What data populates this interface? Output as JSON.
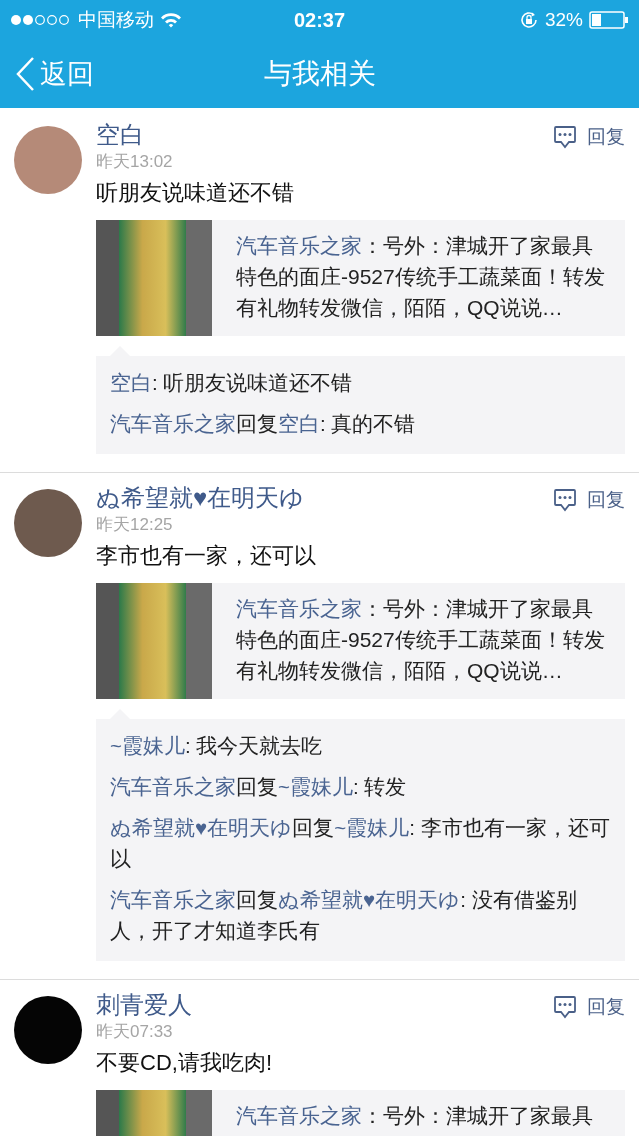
{
  "status_bar": {
    "carrier": "中国移动",
    "time": "02:37",
    "battery": "32%"
  },
  "nav": {
    "back_label": "返回",
    "title": "与我相关"
  },
  "posts": [
    {
      "author": "空白",
      "time": "昨天13:02",
      "text": "听朋友说味道还不错",
      "reply_label": "回复",
      "shared": {
        "source": "汽车音乐之家",
        "text": "：号外：津城开了家最具特色的面庄-9527传统手工蔬菜面！转发有礼物转发微信，陌陌，QQ说说…"
      },
      "comments": [
        {
          "parts": [
            {
              "kind": "name",
              "text": "空白"
            },
            {
              "kind": "text",
              "text": ": 听朋友说味道还不错"
            }
          ]
        },
        {
          "parts": [
            {
              "kind": "name",
              "text": "汽车音乐之家"
            },
            {
              "kind": "text",
              "text": "回复"
            },
            {
              "kind": "name",
              "text": "空白"
            },
            {
              "kind": "text",
              "text": ": 真的不错"
            }
          ]
        }
      ]
    },
    {
      "author": "ぬ希望就♥在明天ゆ",
      "time": "昨天12:25",
      "text": "李市也有一家，还可以",
      "reply_label": "回复",
      "shared": {
        "source": "汽车音乐之家",
        "text": "：号外：津城开了家最具特色的面庄-9527传统手工蔬菜面！转发有礼物转发微信，陌陌，QQ说说…"
      },
      "comments": [
        {
          "parts": [
            {
              "kind": "name",
              "text": "~霞妹儿"
            },
            {
              "kind": "text",
              "text": ": 我今天就去吃"
            }
          ]
        },
        {
          "parts": [
            {
              "kind": "name",
              "text": "汽车音乐之家"
            },
            {
              "kind": "text",
              "text": "回复"
            },
            {
              "kind": "name",
              "text": "~霞妹儿"
            },
            {
              "kind": "text",
              "text": ": 转发"
            }
          ]
        },
        {
          "parts": [
            {
              "kind": "name",
              "text": "ぬ希望就♥在明天ゆ"
            },
            {
              "kind": "text",
              "text": "回复"
            },
            {
              "kind": "name",
              "text": "~霞妹儿"
            },
            {
              "kind": "text",
              "text": ": 李市也有一家，还可以"
            }
          ]
        },
        {
          "parts": [
            {
              "kind": "name",
              "text": "汽车音乐之家"
            },
            {
              "kind": "text",
              "text": "回复"
            },
            {
              "kind": "name",
              "text": "ぬ希望就♥在明天ゆ"
            },
            {
              "kind": "text",
              "text": ": 没有借鉴别人，开了才知道李氏有"
            }
          ]
        }
      ]
    },
    {
      "author": "刺青爱人",
      "time": "昨天07:33",
      "text": "不要CD,请我吃肉!",
      "reply_label": "回复",
      "shared": {
        "source": "汽车音乐之家",
        "text": "：号外：津城开了家最具"
      }
    }
  ]
}
